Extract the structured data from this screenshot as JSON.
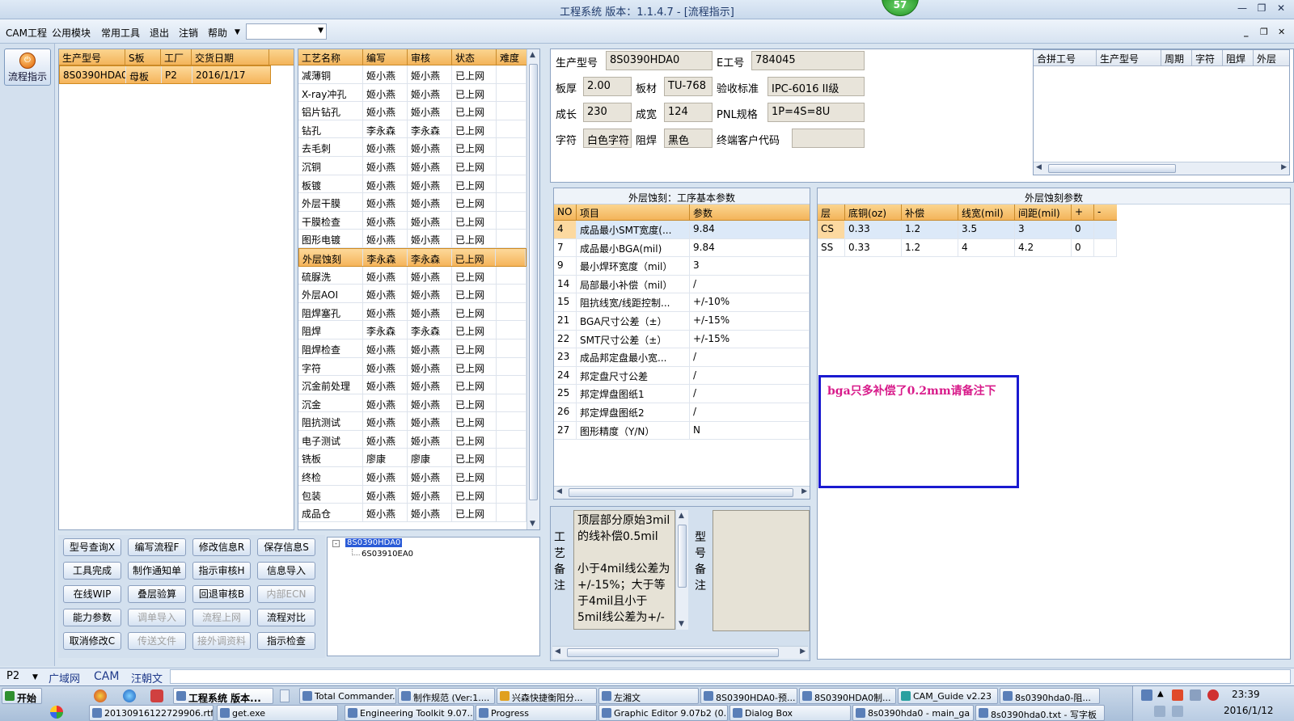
{
  "window": {
    "title": "工程系统  版本：1.1.4.7 - [流程指示]",
    "badge": "57"
  },
  "menu": {
    "items": [
      "CAM工程",
      "公用模块",
      "常用工具",
      "退出",
      "注销",
      "帮助"
    ],
    "combo_value": ""
  },
  "left_nav": {
    "flow_button": "流程指示"
  },
  "order_grid": {
    "columns": [
      "生产型号",
      "S板",
      "工厂",
      "交货日期"
    ],
    "rows": [
      [
        "8S0390HDA0",
        "母板",
        "P2",
        "2016/1/17"
      ]
    ]
  },
  "process_grid": {
    "columns": [
      "工艺名称",
      "编写",
      "审核",
      "状态",
      "难度"
    ],
    "rows": [
      [
        "减薄铜",
        "姬小燕",
        "姬小燕",
        "已上网",
        ""
      ],
      [
        "X-ray冲孔",
        "姬小燕",
        "姬小燕",
        "已上网",
        ""
      ],
      [
        "铝片钻孔",
        "姬小燕",
        "姬小燕",
        "已上网",
        ""
      ],
      [
        "钻孔",
        "李永森",
        "李永森",
        "已上网",
        ""
      ],
      [
        "去毛刺",
        "姬小燕",
        "姬小燕",
        "已上网",
        ""
      ],
      [
        "沉铜",
        "姬小燕",
        "姬小燕",
        "已上网",
        ""
      ],
      [
        "板镀",
        "姬小燕",
        "姬小燕",
        "已上网",
        ""
      ],
      [
        "外层干膜",
        "姬小燕",
        "姬小燕",
        "已上网",
        ""
      ],
      [
        "干膜检查",
        "姬小燕",
        "姬小燕",
        "已上网",
        ""
      ],
      [
        "图形电镀",
        "姬小燕",
        "姬小燕",
        "已上网",
        ""
      ],
      [
        "外层蚀刻",
        "李永森",
        "李永森",
        "已上网",
        ""
      ],
      [
        "硫脲洗",
        "姬小燕",
        "姬小燕",
        "已上网",
        ""
      ],
      [
        "外层AOI",
        "姬小燕",
        "姬小燕",
        "已上网",
        ""
      ],
      [
        "阻焊塞孔",
        "姬小燕",
        "姬小燕",
        "已上网",
        ""
      ],
      [
        "阻焊",
        "李永森",
        "李永森",
        "已上网",
        ""
      ],
      [
        "阻焊检查",
        "姬小燕",
        "姬小燕",
        "已上网",
        ""
      ],
      [
        "字符",
        "姬小燕",
        "姬小燕",
        "已上网",
        ""
      ],
      [
        "沉金前处理",
        "姬小燕",
        "姬小燕",
        "已上网",
        ""
      ],
      [
        "沉金",
        "姬小燕",
        "姬小燕",
        "已上网",
        ""
      ],
      [
        "阻抗测试",
        "姬小燕",
        "姬小燕",
        "已上网",
        ""
      ],
      [
        "电子测试",
        "姬小燕",
        "姬小燕",
        "已上网",
        ""
      ],
      [
        "铣板",
        "廖康",
        "廖康",
        "已上网",
        ""
      ],
      [
        "终检",
        "姬小燕",
        "姬小燕",
        "已上网",
        ""
      ],
      [
        "包装",
        "姬小燕",
        "姬小燕",
        "已上网",
        ""
      ],
      [
        "成品仓",
        "姬小燕",
        "姬小燕",
        "已上网",
        ""
      ]
    ],
    "selected_index": 10
  },
  "buttons": {
    "row1": [
      "型号查询X",
      "编写流程F",
      "修改信息R",
      "保存信息S"
    ],
    "row2": [
      "工具完成",
      "制作通知单",
      "指示审核H",
      "信息导入"
    ],
    "row3": [
      "在线WIP",
      "叠层验算",
      "回退审核B",
      "内部ECN"
    ],
    "row4": [
      "能力参数",
      "调单导入",
      "流程上网",
      "流程对比"
    ],
    "row5": [
      "取消修改C",
      "传送文件",
      "接外调资料",
      "指示检查"
    ]
  },
  "tree": {
    "root": "8S0390HDA0",
    "child": "6S03910EA0"
  },
  "info": {
    "model_label": "生产型号",
    "model": "8S0390HDA0",
    "e_label": "E工号",
    "e_no": "784045",
    "thick_label": "板厚",
    "thick": "2.00",
    "material_label": "板材",
    "material": "TU-768",
    "standard_label": "验收标准",
    "standard": "IPC-6016 II级",
    "len_label": "成长",
    "len": "230",
    "width_label": "成宽",
    "width": "124",
    "pnl_label": "PNL规格",
    "pnl": "1P=4S=8U",
    "char_label": "字符",
    "char": "白色字符",
    "mask_label": "阻焊",
    "mask": "黑色",
    "cust_label": "终端客户代码",
    "cust": ""
  },
  "merge_grid": {
    "columns": [
      "合拼工号",
      "生产型号",
      "周期",
      "字符",
      "阻焊",
      "外层"
    ]
  },
  "params_basic": {
    "title": "外层蚀刻：工序基本参数",
    "columns": [
      "NO",
      "项目",
      "参数"
    ],
    "rows": [
      [
        "4",
        "成品最小SMT宽度(...",
        "9.84"
      ],
      [
        "7",
        "成品最小BGA(mil)",
        "9.84"
      ],
      [
        "9",
        "最小焊环宽度（mil）",
        "3"
      ],
      [
        "14",
        "局部最小补偿（mil）",
        "/"
      ],
      [
        "15",
        "阻抗线宽/线距控制...",
        "+/-10%"
      ],
      [
        "21",
        "BGA尺寸公差（±）",
        "+/-15%"
      ],
      [
        "22",
        "SMT尺寸公差（±）",
        "+/-15%"
      ],
      [
        "23",
        "成品邦定盘最小宽...",
        "/"
      ],
      [
        "24",
        "邦定盘尺寸公差",
        "/"
      ],
      [
        "25",
        "邦定焊盘图纸1",
        "/"
      ],
      [
        "26",
        "邦定焊盘图纸2",
        "/"
      ],
      [
        "27",
        "图形精度（Y/N）",
        "N"
      ]
    ]
  },
  "params_etch": {
    "title": "外层蚀刻参数",
    "columns": [
      "层",
      "底铜(oz)",
      "补偿",
      "线宽(mil)",
      "间距(mil)",
      "+",
      "-"
    ],
    "rows": [
      [
        "CS",
        "0.33",
        "1.2",
        "3.5",
        "3",
        "0",
        ""
      ],
      [
        "SS",
        "0.33",
        "1.2",
        "4",
        "4.2",
        "0",
        ""
      ]
    ]
  },
  "note_popup": "bga只多补偿了0.2mm请备注下",
  "process_note": {
    "label": "工艺备注",
    "text": "顶层部分原始3mil的线补偿0.5mil\n\n小于4mil线公差为+/-15%；大于等于4mil且小于5mil线公差为+/-"
  },
  "model_note": {
    "label": "型号备注"
  },
  "status_bar": {
    "factory": "P2",
    "net": "广域网",
    "dept": "CAM",
    "user": "汪朝文"
  },
  "taskbar": {
    "start": "开始",
    "row1": [
      "工程系统  版本...",
      "Total Commander...",
      "制作规范 (Ver:1....",
      "兴森快捷衡阳分...",
      "左湘文",
      "8S0390HDA0-预...",
      "8S0390HDA0制...",
      "CAM_Guide v2.23",
      "8s0390hda0-阻..."
    ],
    "row2": [
      "20130916122729906.rtf...",
      "get.exe",
      "Engineering Toolkit 9.07...",
      "Progress",
      "Graphic Editor 9.07b2 (0...",
      "Dialog Box",
      "8s0390hda0 - main_ga",
      "8s0390hda0.txt - 写字板"
    ],
    "time": "23:39",
    "date": "2016/1/12"
  },
  "colors": {
    "accent": "#f3b45a",
    "popup_border": "#1a1ad0",
    "popup_text": "#d81b8a"
  }
}
